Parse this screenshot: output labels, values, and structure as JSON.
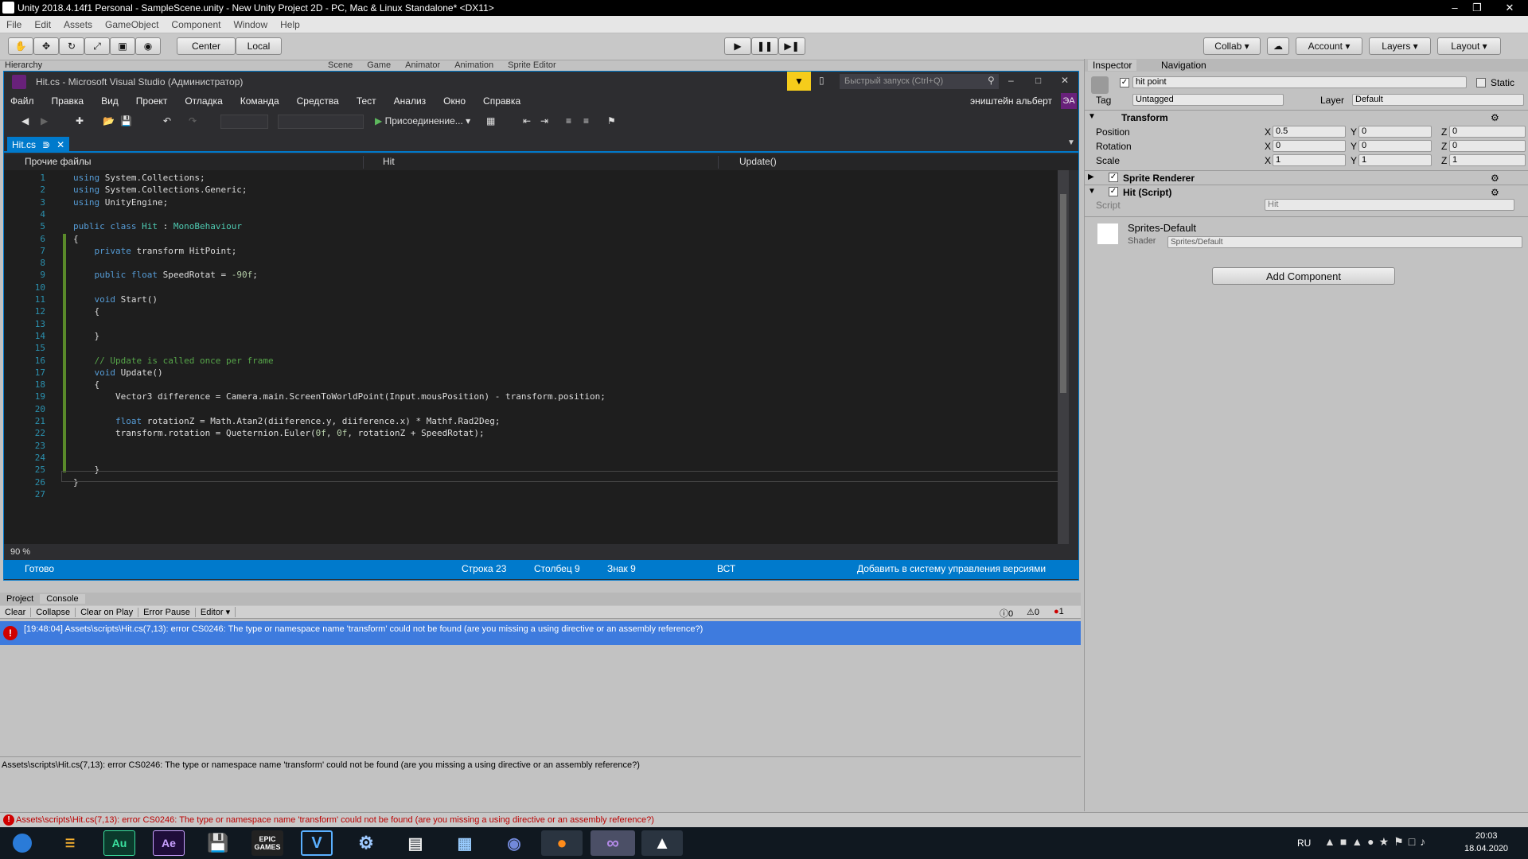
{
  "window": {
    "title": "Unity 2018.4.14f1 Personal - SampleScene.unity - New Unity Project 2D - PC, Mac & Linux Standalone* <DX11>"
  },
  "menu": [
    "File",
    "Edit",
    "Assets",
    "GameObject",
    "Component",
    "Window",
    "Help"
  ],
  "toolbar": {
    "center": "Center",
    "local": "Local",
    "collab": "Collab",
    "account": "Account",
    "layers": "Layers",
    "layout": "Layout"
  },
  "panels": {
    "hierarchy": "Hierarchy",
    "scene": "Scene",
    "game": "Game",
    "animator": "Animator",
    "animation": "Animation",
    "sprite_editor": "Sprite Editor"
  },
  "vs": {
    "title": "Hit.cs - Microsoft Visual Studio  (Администратор)",
    "quick_launch": "Быстрый запуск (Ctrl+Q)",
    "user": "эништейн альберт",
    "user_initials": "ЭА",
    "menu": [
      "Файл",
      "Правка",
      "Вид",
      "Проект",
      "Отладка",
      "Команда",
      "Средства",
      "Тест",
      "Анализ",
      "Окно",
      "Справка"
    ],
    "attach": "Присоединение...",
    "tab": "Hit.cs",
    "nav": {
      "files": "Прочие файлы",
      "class": "Hit",
      "method": "Update()"
    },
    "zoom": "90 %",
    "status": {
      "ready": "Готово",
      "line": "Строка 23",
      "col": "Столбец 9",
      "ch": "Знак 9",
      "ins": "ВСТ",
      "vcs": "Добавить в систему управления версиями"
    }
  },
  "code": [
    "using System.Collections;",
    "using System.Collections.Generic;",
    "using UnityEngine;",
    "",
    "public class Hit : MonoBehaviour",
    "{",
    "    private transform HitPoint;",
    "",
    "    public float SpeedRotat = -90f;",
    "",
    "    void Start()",
    "    {",
    "",
    "    }",
    "",
    "    // Update is called once per frame",
    "    void Update()",
    "    {",
    "        Vector3 difference = Camera.main.ScreenToWorldPoint(Input.mousPosition) - transform.position;",
    "",
    "        float rotationZ = Math.Atan2(diiference.y, diiference.x) * Mathf.Rad2Deg;",
    "        transform.rotation = Queternion.Euler(0f, 0f, rotationZ + SpeedRotat);",
    "",
    "",
    "    }",
    "}",
    ""
  ],
  "inspector": {
    "tab": "Inspector",
    "nav": "Navigation",
    "object_name": "hit point",
    "static": "Static",
    "tag_label": "Tag",
    "tag": "Untagged",
    "layer_label": "Layer",
    "layer": "Default",
    "transform": "Transform",
    "position": {
      "label": "Position",
      "x": "0.5",
      "y": "0",
      "z": "0"
    },
    "rotation": {
      "label": "Rotation",
      "x": "0",
      "y": "0",
      "z": "0"
    },
    "scale": {
      "label": "Scale",
      "x": "1",
      "y": "1",
      "z": "1"
    },
    "sprite_renderer": "Sprite Renderer",
    "hit_script": "Hit (Script)",
    "script_label": "Script",
    "script": "Hit",
    "material": "Sprites-Default",
    "shader_label": "Shader",
    "shader": "Sprites/Default",
    "add_component": "Add Component"
  },
  "console": {
    "project_tab": "Project",
    "console_tab": "Console",
    "buttons": [
      "Clear",
      "Collapse",
      "Clear on Play",
      "Error Pause",
      "Editor"
    ],
    "counts": {
      "info": "0",
      "warn": "0",
      "error": "1"
    },
    "entry": "[19:48:04] Assets\\scripts\\Hit.cs(7,13): error CS0246: The type or namespace name 'transform' could not be found (are you missing a using directive or an assembly reference?)",
    "detail": "Assets\\scripts\\Hit.cs(7,13): error CS0246: The type or namespace name 'transform' could not be found (are you missing a using directive or an assembly reference?)",
    "status": "Assets\\scripts\\Hit.cs(7,13): error CS0246: The type or namespace name 'transform' could not be found (are you missing a using directive or an assembly reference?)"
  },
  "taskbar": {
    "lang": "RU",
    "time": "20:03",
    "date": "18.04.2020",
    "apps": [
      "Au",
      "Ae",
      "EPIC GAMES",
      "V"
    ]
  },
  "colors": {
    "vs_accent": "#007acc",
    "error": "#d00000",
    "console_selected": "#3e7bde"
  }
}
